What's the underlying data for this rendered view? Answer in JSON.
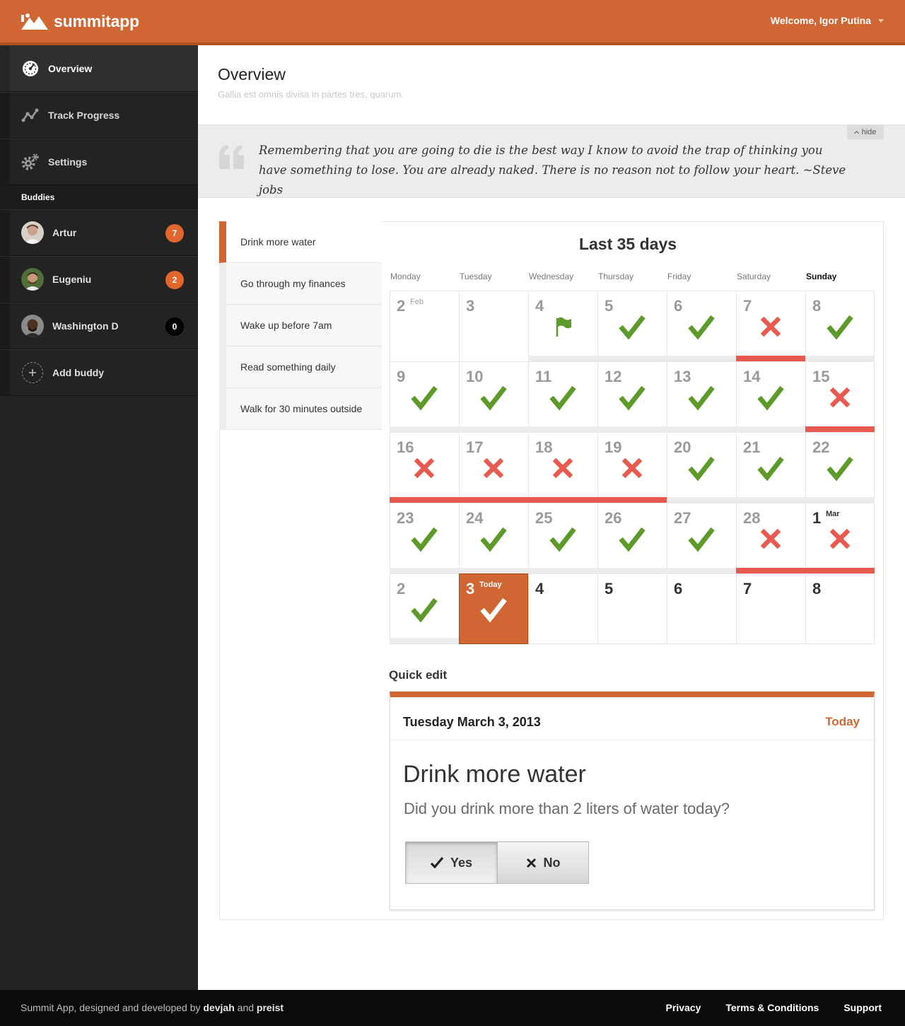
{
  "header": {
    "app_name": "summitapp",
    "welcome": "Welcome, Igor Putina",
    "brand_color": "#cf6633"
  },
  "sidebar": {
    "nav": [
      {
        "label": "Overview",
        "icon": "dashboard-icon",
        "active": true
      },
      {
        "label": "Track Progress",
        "icon": "progress-chart-icon",
        "active": false
      },
      {
        "label": "Settings",
        "icon": "gear-icon",
        "active": false
      }
    ],
    "buddies_label": "Buddies",
    "buddies": [
      {
        "name": "Artur",
        "count": "7"
      },
      {
        "name": "Eugeniu",
        "count": "2"
      },
      {
        "name": "Washington D",
        "count": "0"
      }
    ],
    "add_buddy": "Add buddy"
  },
  "page": {
    "title": "Overview",
    "subtitle": "Gallia est omnis divisa in partes tres, quarum."
  },
  "quote": {
    "text": "Remembering that you are going to die is the best way I know to avoid the trap of thinking you have something to lose. You are already naked. There is no reason not to follow your heart.  ~Steve jobs",
    "hide_label": "hide"
  },
  "habits": [
    "Drink more water",
    "Go through my finances",
    "Wake up before 7am",
    "Read something daily",
    "Walk for 30 minutes outside"
  ],
  "calendar": {
    "title": "Last 35 days",
    "weekdays": [
      "Monday",
      "Tuesday",
      "Wednesday",
      "Thursday",
      "Friday",
      "Saturday",
      "Sunday"
    ],
    "today_label": "Today",
    "days": [
      {
        "d": "2",
        "mon": "Feb",
        "s": "none"
      },
      {
        "d": "3",
        "s": "none"
      },
      {
        "d": "4",
        "s": "flag"
      },
      {
        "d": "5",
        "s": "check"
      },
      {
        "d": "6",
        "s": "check"
      },
      {
        "d": "7",
        "s": "cross"
      },
      {
        "d": "8",
        "s": "check"
      },
      {
        "d": "9",
        "s": "check"
      },
      {
        "d": "10",
        "s": "check"
      },
      {
        "d": "11",
        "s": "check"
      },
      {
        "d": "12",
        "s": "check"
      },
      {
        "d": "13",
        "s": "check"
      },
      {
        "d": "14",
        "s": "check"
      },
      {
        "d": "15",
        "s": "cross"
      },
      {
        "d": "16",
        "s": "cross"
      },
      {
        "d": "17",
        "s": "cross"
      },
      {
        "d": "18",
        "s": "cross"
      },
      {
        "d": "19",
        "s": "cross"
      },
      {
        "d": "20",
        "s": "check"
      },
      {
        "d": "21",
        "s": "check"
      },
      {
        "d": "22",
        "s": "check"
      },
      {
        "d": "23",
        "s": "check"
      },
      {
        "d": "24",
        "s": "check"
      },
      {
        "d": "25",
        "s": "check"
      },
      {
        "d": "26",
        "s": "check"
      },
      {
        "d": "27",
        "s": "check"
      },
      {
        "d": "28",
        "s": "cross"
      },
      {
        "d": "1",
        "mon": "Mar",
        "s": "cross"
      },
      {
        "d": "2",
        "s": "check"
      },
      {
        "d": "3",
        "s": "today"
      },
      {
        "d": "4",
        "s": "future"
      },
      {
        "d": "5",
        "s": "future"
      },
      {
        "d": "6",
        "s": "future"
      },
      {
        "d": "7",
        "s": "future"
      },
      {
        "d": "8",
        "s": "future"
      }
    ]
  },
  "quick_edit": {
    "label": "Quick edit",
    "date": "Tuesday March 3, 2013",
    "today": "Today",
    "habit": "Drink more water",
    "question": "Did you drink more than 2 liters of water today?",
    "yes": "Yes",
    "no": "No"
  },
  "footer": {
    "credit_prefix": "Summit App, designed and developed by",
    "author1": "devjah",
    "and": "and",
    "author2": "preist",
    "links": [
      "Privacy",
      "Terms & Conditions",
      "Support"
    ]
  },
  "colors": {
    "check": "#5d9a2a",
    "cross": "#e85a4f",
    "accent": "#cf6633"
  }
}
